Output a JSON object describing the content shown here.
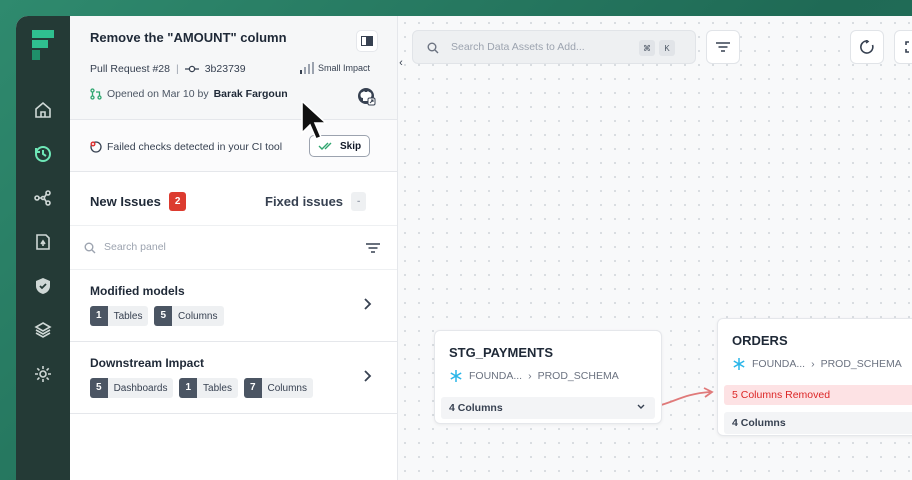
{
  "pr": {
    "title": "Remove the \"AMOUNT\" column",
    "number": "Pull Request #28",
    "commit": "3b23739",
    "impact": "Small Impact",
    "opened_prefix": "Opened on Mar 10 by",
    "author": "Barak Fargoun"
  },
  "checks": {
    "text": "Failed checks detected in your CI tool",
    "skip_label": "Skip"
  },
  "issues": {
    "new_label": "New Issues",
    "new_count": "2",
    "fixed_label": "Fixed issues",
    "fixed_count": "-"
  },
  "panel_search": {
    "placeholder": "Search panel"
  },
  "groups": [
    {
      "title": "Modified models",
      "chips": [
        {
          "n": "1",
          "label": "Tables"
        },
        {
          "n": "5",
          "label": "Columns"
        }
      ]
    },
    {
      "title": "Downstream Impact",
      "chips": [
        {
          "n": "5",
          "label": "Dashboards"
        },
        {
          "n": "1",
          "label": "Tables"
        },
        {
          "n": "7",
          "label": "Columns"
        }
      ]
    }
  ],
  "canvas": {
    "search_placeholder": "Search Data Assets to Add...",
    "kbd1": "⌘",
    "kbd2": "K"
  },
  "nodes": [
    {
      "title": "STG_PAYMENTS",
      "db": "FOUNDA...",
      "schema": "PROD_SCHEMA",
      "columns": "4 Columns"
    },
    {
      "title": "ORDERS",
      "db": "FOUNDA...",
      "schema": "PROD_SCHEMA",
      "removed": "5 Columns Removed",
      "columns": "4 Columns"
    }
  ],
  "colors": {
    "accent": "#2f8a6e",
    "rail": "#243a36",
    "danger": "#dc3b2f"
  }
}
